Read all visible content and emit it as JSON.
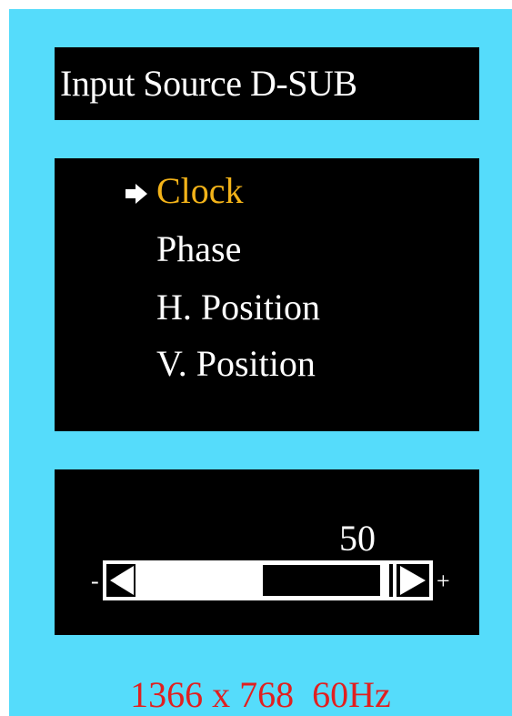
{
  "header": {
    "title": "Input  Source D-SUB"
  },
  "menu": {
    "items": [
      {
        "label": "Clock",
        "selected": true
      },
      {
        "label": "Phase",
        "selected": false
      },
      {
        "label": "H. Position",
        "selected": false
      },
      {
        "label": "V. Position",
        "selected": false
      }
    ],
    "selector_icon": "right-arrow-icon"
  },
  "slider": {
    "value": "50",
    "fill_fraction": 0.5,
    "minus_label": "-",
    "plus_label": "+",
    "decrease_icon": "left-triangle-icon",
    "increase_icon": "right-triangle-icon"
  },
  "status": {
    "resolution": "1366 x 768  60Hz"
  },
  "colors": {
    "background": "#55dcfb",
    "panel": "#000000",
    "text": "#ffffff",
    "selected": "#f3b319",
    "status_text": "#e02020"
  }
}
